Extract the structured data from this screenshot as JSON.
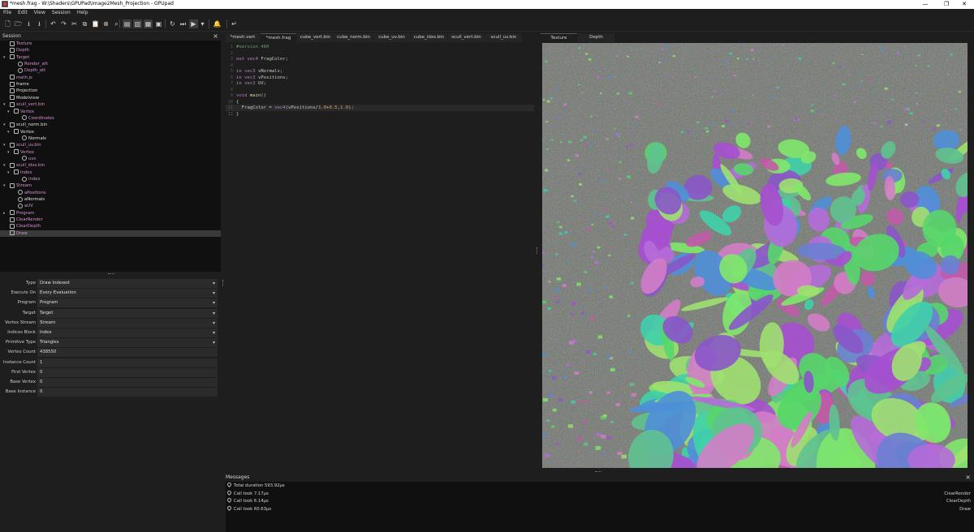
{
  "window": {
    "title": "*mesh.frag - W:\\Shaders\\GPUPad\\Image2Mesh_Projection - GPUpad"
  },
  "menu": [
    "File",
    "Edit",
    "View",
    "Session",
    "Help"
  ],
  "toolbar": {
    "icons": [
      "new-file-icon",
      "open-file-icon",
      "save-icon",
      "save-all-icon",
      "undo-icon",
      "redo-icon",
      "cut-icon",
      "copy-icon",
      "paste-icon",
      "delete-icon",
      "find-icon",
      "auto-layout-icon",
      "sync-icon",
      "palette-icon",
      "screenshot-icon",
      "reload-icon",
      "step-icon",
      "play-icon",
      "dropdown-icon",
      "bell-icon",
      "return-icon"
    ]
  },
  "session": {
    "title": "Session",
    "items": [
      {
        "label": "Texture",
        "depth": 0,
        "color": "pink",
        "icon": "texture-icon",
        "arrow": ""
      },
      {
        "label": "Depth",
        "depth": 0,
        "color": "pink",
        "icon": "texture-icon",
        "arrow": ""
      },
      {
        "label": "Target",
        "depth": 0,
        "color": "pink",
        "icon": "target-icon",
        "arrow": "▾"
      },
      {
        "label": "Render_att",
        "depth": 2,
        "color": "pink",
        "icon": "link-icon",
        "arrow": ""
      },
      {
        "label": "Depth_att",
        "depth": 2,
        "color": "pink",
        "icon": "link-icon",
        "arrow": ""
      },
      {
        "label": "math.js",
        "depth": 0,
        "color": "pink",
        "icon": "script-icon",
        "arrow": ""
      },
      {
        "label": "frame",
        "depth": 0,
        "color": "white",
        "icon": "binding-icon",
        "arrow": ""
      },
      {
        "label": "Projection",
        "depth": 0,
        "color": "white",
        "icon": "binding-icon",
        "arrow": ""
      },
      {
        "label": "Modelview",
        "depth": 0,
        "color": "white",
        "icon": "binding-icon",
        "arrow": ""
      },
      {
        "label": "scull_vert.bin",
        "depth": 0,
        "color": "pink",
        "icon": "buffer-icon",
        "arrow": "▾"
      },
      {
        "label": "Vertex",
        "depth": 1,
        "color": "pink",
        "icon": "block-icon",
        "arrow": "▾"
      },
      {
        "label": "Coordinates",
        "depth": 3,
        "color": "pink",
        "icon": "link-icon",
        "arrow": ""
      },
      {
        "label": "scull_norm.bin",
        "depth": 0,
        "color": "white",
        "icon": "buffer-icon",
        "arrow": "▾"
      },
      {
        "label": "Vertex",
        "depth": 1,
        "color": "white",
        "icon": "block-icon",
        "arrow": "▾"
      },
      {
        "label": "Normals",
        "depth": 3,
        "color": "white",
        "icon": "link-icon",
        "arrow": ""
      },
      {
        "label": "scull_uv.bin",
        "depth": 0,
        "color": "pink",
        "icon": "buffer-icon",
        "arrow": "▾"
      },
      {
        "label": "Vertex",
        "depth": 1,
        "color": "pink",
        "icon": "block-icon",
        "arrow": "▾"
      },
      {
        "label": "uvs",
        "depth": 3,
        "color": "pink",
        "icon": "link-icon",
        "arrow": ""
      },
      {
        "label": "scull_idxs.bin",
        "depth": 0,
        "color": "pink",
        "icon": "buffer-icon",
        "arrow": "▾"
      },
      {
        "label": "Index",
        "depth": 1,
        "color": "pink",
        "icon": "block-icon",
        "arrow": "▾"
      },
      {
        "label": "index",
        "depth": 3,
        "color": "pink",
        "icon": "link-icon",
        "arrow": ""
      },
      {
        "label": "Stream",
        "depth": 0,
        "color": "pink",
        "icon": "stream-icon",
        "arrow": "▾"
      },
      {
        "label": "aPositions",
        "depth": 2,
        "color": "pink",
        "icon": "link-icon",
        "arrow": ""
      },
      {
        "label": "aNormals",
        "depth": 2,
        "color": "white",
        "icon": "link-icon",
        "arrow": ""
      },
      {
        "label": "aUV",
        "depth": 2,
        "color": "pink",
        "icon": "link-icon",
        "arrow": ""
      },
      {
        "label": "Program",
        "depth": 0,
        "color": "pink",
        "icon": "program-icon",
        "arrow": "▸"
      },
      {
        "label": "ClearRender",
        "depth": 0,
        "color": "pink",
        "icon": "checkbox-icon",
        "arrow": ""
      },
      {
        "label": "ClearDepth",
        "depth": 0,
        "color": "pink",
        "icon": "checkbox-icon",
        "arrow": ""
      },
      {
        "label": "Draw",
        "depth": 0,
        "color": "pink",
        "icon": "checkbox-icon",
        "arrow": "",
        "selected": true
      }
    ]
  },
  "properties": [
    {
      "label": "Type",
      "value": "Draw Indexed",
      "combo": true
    },
    {
      "label": "Execute On",
      "value": "Every Evaluation",
      "combo": true
    },
    {
      "label": "Program",
      "value": "Program",
      "combo": true
    },
    {
      "label": "Target",
      "value": "Target",
      "combo": true
    },
    {
      "label": "Vertex Stream",
      "value": "Stream",
      "combo": true
    },
    {
      "label": "Indices Block",
      "value": "Index",
      "combo": true
    },
    {
      "label": "Primitive Type",
      "value": "Triangles",
      "combo": true
    },
    {
      "label": "Vertex Count",
      "value": "438550",
      "combo": false
    },
    {
      "label": "Instance Count",
      "value": "1",
      "combo": false
    },
    {
      "label": "First Vertex",
      "value": "0",
      "combo": false
    },
    {
      "label": "Base Vertex",
      "value": "0",
      "combo": false
    },
    {
      "label": "Base Instance",
      "value": "0",
      "combo": false
    }
  ],
  "editor": {
    "tabs": [
      "*mesh.vert",
      "*mesh.frag",
      "cube_vert.bin",
      "cube_norm.bin",
      "cube_uv.bin",
      "cube_idxs.bin",
      "scull_vert.bin",
      "scull_uv.bin"
    ],
    "active_tab": 1,
    "lines": [
      {
        "n": "1",
        "html": "<span class='pp'>#version 460</span>"
      },
      {
        "n": "2",
        "html": ""
      },
      {
        "n": "3",
        "html": "<span class='kw'>out</span> <span class='ty'>vec4</span> FragColor;"
      },
      {
        "n": "4",
        "html": ""
      },
      {
        "n": "5",
        "html": "<span class='kw'>in</span> <span class='ty'>vec3</span> vNormals;"
      },
      {
        "n": "6",
        "html": "<span class='kw'>in</span> <span class='ty'>vec3</span> vPositions;"
      },
      {
        "n": "7",
        "html": "<span class='kw'>in</span> <span class='ty'>vec2</span> UV;"
      },
      {
        "n": "8",
        "html": ""
      },
      {
        "n": "9",
        "html": "<span class='ty'>void</span> <span class='fn'>main</span>()"
      },
      {
        "n": "10",
        "html": "{"
      },
      {
        "n": "11",
        "html": "  FragColor = <span class='ty'>vec4</span>(vPositions/<span class='num'>1.0</span>+<span class='num'>0.5</span>,<span class='num'>1.0</span>);"
      },
      {
        "n": "12",
        "html": "}"
      }
    ]
  },
  "preview": {
    "tabs": [
      "Texture",
      "Depth"
    ]
  },
  "messages": {
    "title": "Messages",
    "items": [
      {
        "text": "Total duration 593.92µs",
        "source": ""
      },
      {
        "text": "Call took 7.17µs",
        "source": "ClearRender"
      },
      {
        "text": "Call took 6.14µs",
        "source": "ClearDepth"
      },
      {
        "text": "Call took 60.63µs",
        "source": "Draw"
      }
    ]
  },
  "colors": {
    "accent_pink": "#d98fd2",
    "panel": "#101010",
    "background": "#1e1e1e"
  }
}
